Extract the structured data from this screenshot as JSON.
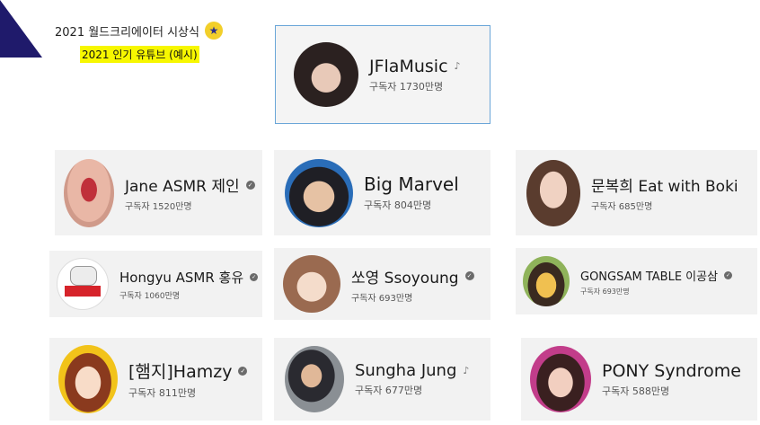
{
  "header": {
    "event_title": "2021 월드크리에이터 시상식",
    "subtitle": "2021 인기 유튜브 (예시)"
  },
  "featured": {
    "name": "JFlaMusic",
    "subs": "구독자 1730만명",
    "badge": "music-note"
  },
  "channels": [
    {
      "name": "Jane ASMR 제인",
      "subs": "구독자 1520만명",
      "badge": "verified"
    },
    {
      "name": "Big Marvel",
      "subs": "구독자 804만명",
      "badge": "none"
    },
    {
      "name": "문복희 Eat with Boki",
      "subs": "구독자 685만명",
      "badge": "none"
    },
    {
      "name": "Hongyu ASMR 홍유",
      "subs": "구독자 1060만명",
      "badge": "verified"
    },
    {
      "name": "쏘영 Ssoyoung",
      "subs": "구독자 693만명",
      "badge": "verified"
    },
    {
      "name": "GONGSAM TABLE 이공삼",
      "subs": "구독자 693만명",
      "badge": "verified"
    },
    {
      "name": "[햄지]Hamzy",
      "subs": "구독자 811만명",
      "badge": "verified"
    },
    {
      "name": "Sungha Jung",
      "subs": "구독자 677만명",
      "badge": "music-note"
    },
    {
      "name": "PONY Syndrome",
      "subs": "구독자 588만명",
      "badge": "none"
    }
  ],
  "colors": {
    "accent_highlight": "#f7f700",
    "featured_border": "#6aa6d8",
    "triangle": "#1f1a6b",
    "star_badge": "#f2cf2a"
  }
}
